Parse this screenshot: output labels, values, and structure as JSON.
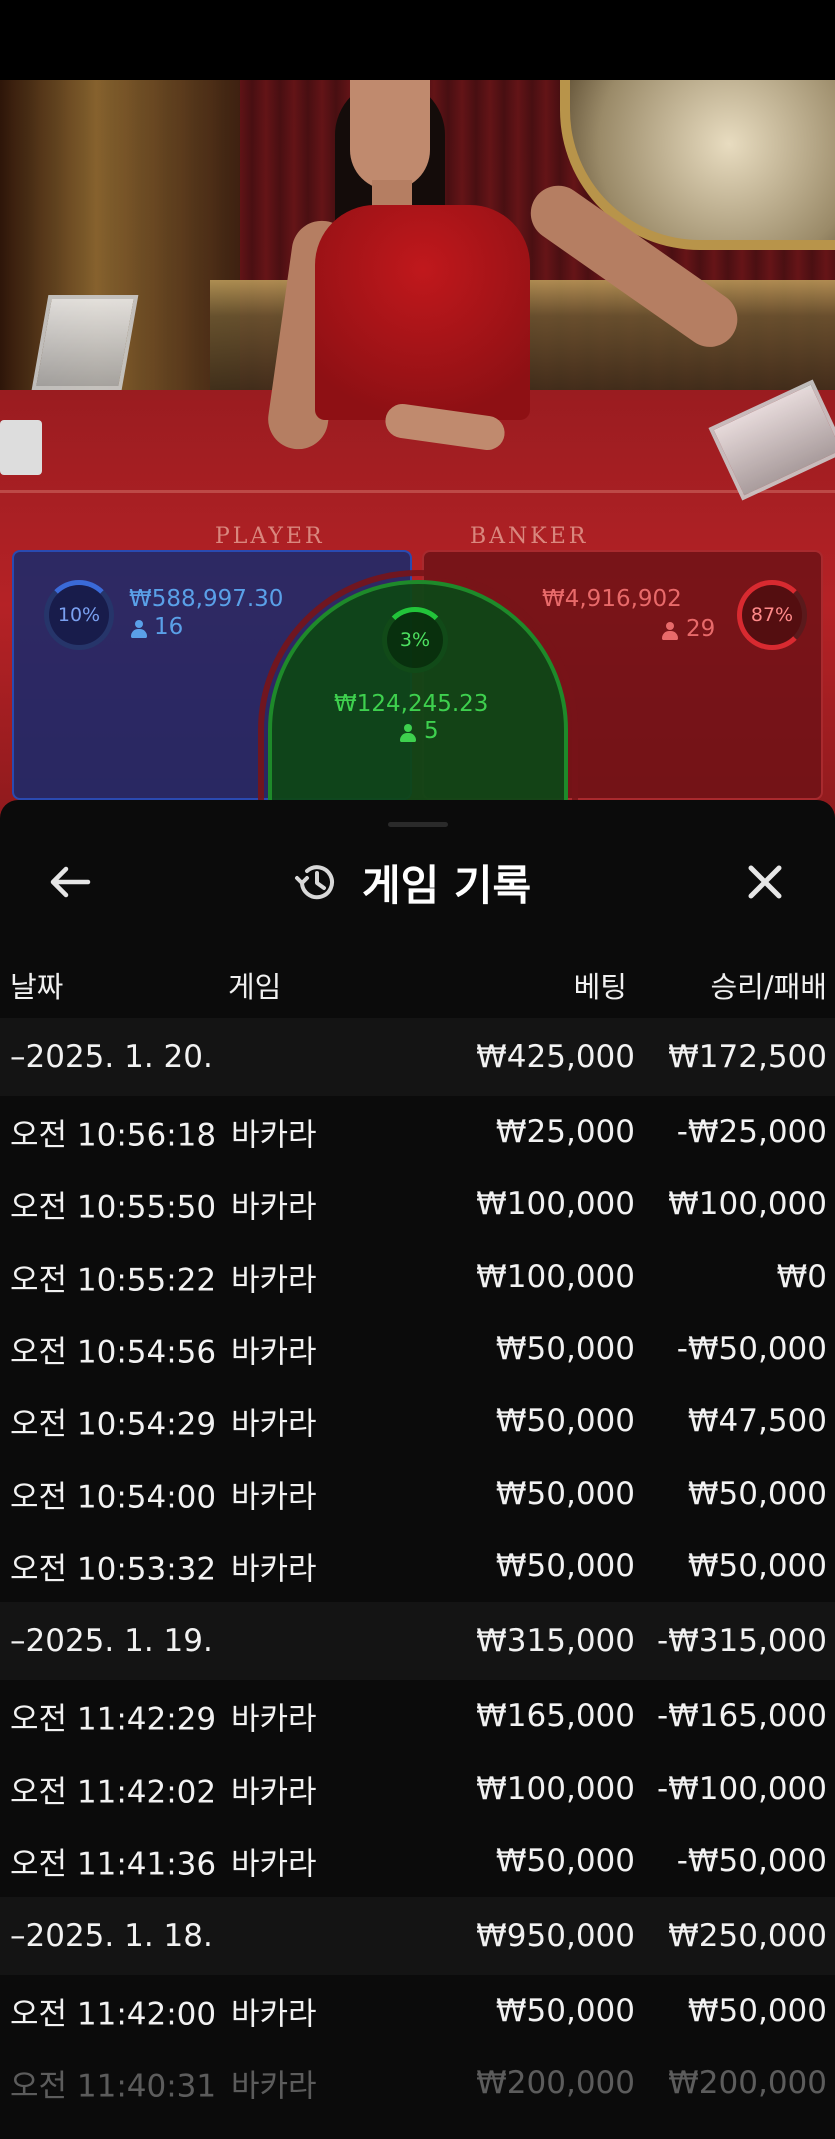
{
  "video": {
    "table_label_player": "PLAYER",
    "table_label_banker": "BANKER"
  },
  "bets": {
    "player": {
      "percent": "10%",
      "amount": "₩588,997.30",
      "count": "16",
      "color": "#2a4ab0"
    },
    "tie": {
      "percent": "3%",
      "amount": "₩124,245.23",
      "count": "5",
      "color": "#1e8a2a"
    },
    "banker": {
      "percent": "87%",
      "amount": "₩4,916,902",
      "count": "29",
      "color": "#a82a2e"
    }
  },
  "sheet": {
    "title": "게임 기록",
    "icons": {
      "back": "arrow-left-icon",
      "history": "history-icon",
      "close": "close-icon"
    },
    "columns": {
      "date": "날짜",
      "game": "게임",
      "bet": "베팅",
      "win": "승리/패배"
    },
    "rows": [
      {
        "type": "group",
        "date": "–2025. 1. 20.",
        "game": "",
        "bet": "₩425,000",
        "win": "₩172,500"
      },
      {
        "type": "item",
        "date": "오전 10:56:18",
        "game": "바카라",
        "bet": "₩25,000",
        "win": "-₩25,000"
      },
      {
        "type": "item",
        "date": "오전 10:55:50",
        "game": "바카라",
        "bet": "₩100,000",
        "win": "₩100,000"
      },
      {
        "type": "item",
        "date": "오전 10:55:22",
        "game": "바카라",
        "bet": "₩100,000",
        "win": "₩0"
      },
      {
        "type": "item",
        "date": "오전 10:54:56",
        "game": "바카라",
        "bet": "₩50,000",
        "win": "-₩50,000"
      },
      {
        "type": "item",
        "date": "오전 10:54:29",
        "game": "바카라",
        "bet": "₩50,000",
        "win": "₩47,500"
      },
      {
        "type": "item",
        "date": "오전 10:54:00",
        "game": "바카라",
        "bet": "₩50,000",
        "win": "₩50,000"
      },
      {
        "type": "item",
        "date": "오전 10:53:32",
        "game": "바카라",
        "bet": "₩50,000",
        "win": "₩50,000"
      },
      {
        "type": "group",
        "date": "–2025. 1. 19.",
        "game": "",
        "bet": "₩315,000",
        "win": "-₩315,000"
      },
      {
        "type": "item",
        "date": "오전 11:42:29",
        "game": "바카라",
        "bet": "₩165,000",
        "win": "-₩165,000"
      },
      {
        "type": "item",
        "date": "오전 11:42:02",
        "game": "바카라",
        "bet": "₩100,000",
        "win": "-₩100,000"
      },
      {
        "type": "item",
        "date": "오전 11:41:36",
        "game": "바카라",
        "bet": "₩50,000",
        "win": "-₩50,000"
      },
      {
        "type": "group",
        "date": "–2025. 1. 18.",
        "game": "",
        "bet": "₩950,000",
        "win": "₩250,000"
      },
      {
        "type": "item",
        "date": "오전 11:42:00",
        "game": "바카라",
        "bet": "₩50,000",
        "win": "₩50,000"
      },
      {
        "type": "item",
        "date": "오전 11:40:31",
        "game": "바카라",
        "bet": "₩200,000",
        "win": "₩200,000"
      }
    ]
  }
}
